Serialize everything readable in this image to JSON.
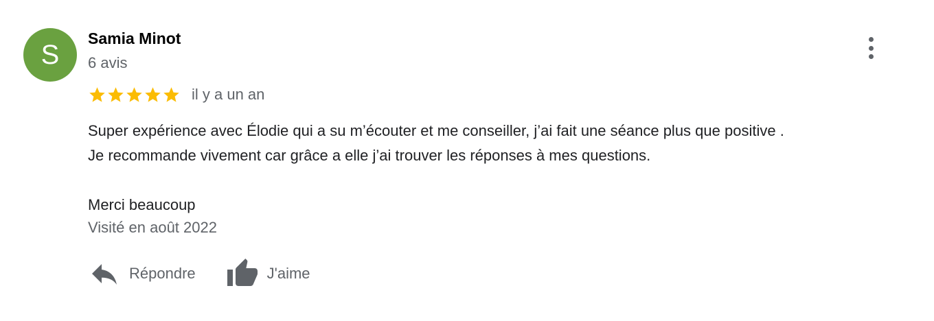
{
  "reviewer": {
    "initial": "S",
    "name": "Samia Minot",
    "review_count": "6 avis",
    "avatar_color": "#6aa140"
  },
  "review": {
    "rating": 5,
    "max_rating": 5,
    "star_color": "#fbbc04",
    "time_ago": "il y a un an",
    "text": "Super expérience avec Élodie qui a su m’écouter et me conseiller, j’ai fait une séance plus que positive .\nJe recommande vivement car grâce a elle j’ai trouver les réponses à mes questions.\n\nMerci beaucoup",
    "visited": "Visité en août 2022"
  },
  "actions": {
    "reply_label": "Répondre",
    "like_label": "J'aime",
    "icon_color": "#5f6368"
  },
  "icons": {
    "more": "more-vert-icon",
    "reply": "reply-arrow-icon",
    "like": "thumbs-up-icon",
    "star": "star-icon"
  }
}
